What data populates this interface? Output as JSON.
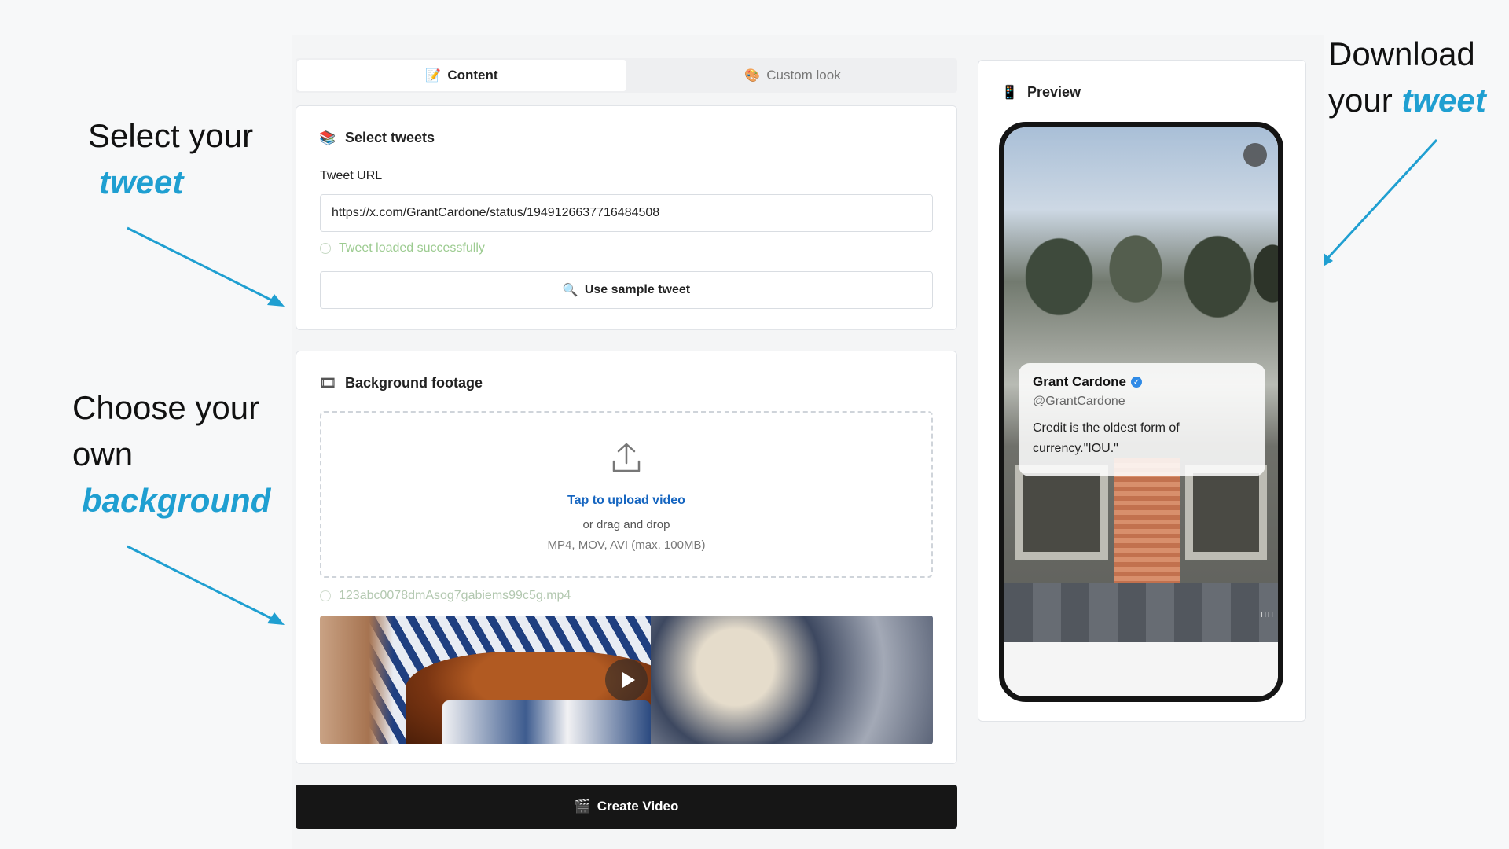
{
  "annotations": {
    "select_line1": "Select your",
    "select_emph": "tweet",
    "choose_line1": "Choose your",
    "choose_line2": "own",
    "choose_emph": "background",
    "download_line1": "Download",
    "download_line2": "your",
    "download_emph": "tweet"
  },
  "tabs": [
    {
      "label": "Content",
      "icon": "document-icon",
      "active": true
    },
    {
      "label": "Custom look",
      "icon": "palette-icon",
      "active": false
    }
  ],
  "select_tweets": {
    "title": "Select tweets",
    "url_label": "Tweet URL",
    "url_value": "https://x.com/GrantCardone/status/1949126637716484508",
    "status": "Tweet loaded successfully",
    "sample_button": "Use sample tweet"
  },
  "background_footage": {
    "title": "Background footage",
    "upload_link": "Tap to upload video",
    "upload_sub": "or drag and drop",
    "upload_formats": "MP4, MOV, AVI (max. 100MB)",
    "file_name": "123abc0078dmAsog7gabiems99c5g.mp4"
  },
  "create_button": "Create Video",
  "preview": {
    "title": "Preview",
    "tweet_name": "Grant Cardone",
    "tweet_handle": "@GrantCardone",
    "tweet_text": "Credit is the oldest form of currency.\"IOU.\"",
    "watermark": "TITI"
  },
  "colors": {
    "accent": "#1f9fd1",
    "link": "#1565c0",
    "success": "#9ccb90",
    "primary_button": "#161616"
  }
}
